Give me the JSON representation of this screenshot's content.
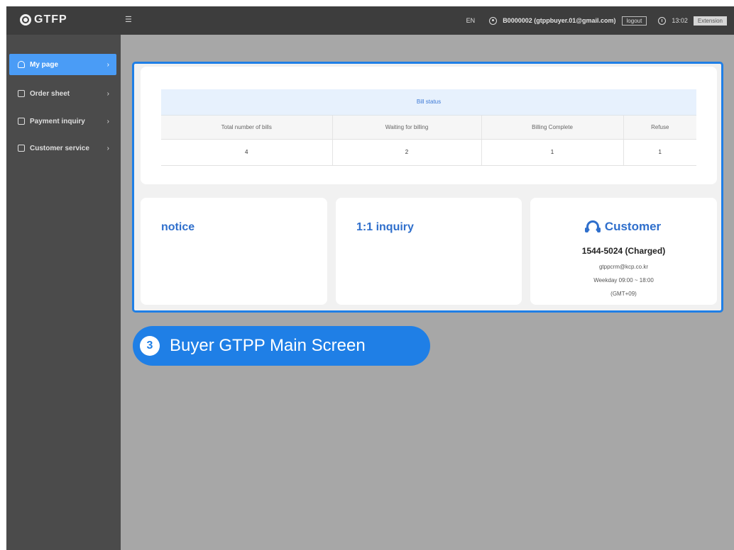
{
  "header": {
    "logo_text": "GTFP",
    "language": "EN",
    "user": "B0000002 (gtppbuyer.01@gmail.com)",
    "logout_label": "logout",
    "time": "13:02",
    "extension_label": "Extension"
  },
  "sidebar": {
    "items": [
      {
        "label": "My page",
        "icon": "person-icon",
        "active": true
      },
      {
        "label": "Order sheet",
        "icon": "document-icon",
        "active": false
      },
      {
        "label": "Payment inquiry",
        "icon": "clipboard-icon",
        "active": false
      },
      {
        "label": "Customer service",
        "icon": "grid-icon",
        "active": false
      }
    ]
  },
  "bill_status": {
    "caption": "Bill status",
    "columns": [
      "Total number of bills",
      "Waiting for billing",
      "Billing Complete",
      "Refuse"
    ],
    "values": [
      "4",
      "2",
      "1",
      "1"
    ]
  },
  "cards": {
    "notice_title": "notice",
    "inquiry_title": "1:1 inquiry",
    "customer": {
      "title": "Customer",
      "phone": "1544-5024 (Charged)",
      "email": "gtppcrm@kcp.co.kr",
      "hours": "Weekday 09:00 ~ 18:00",
      "timezone": "(GMT+09)"
    }
  },
  "step": {
    "number": "3",
    "label": "Buyer GTPP Main Screen"
  },
  "colors": {
    "accent": "#1f7fe6",
    "sidebar_active": "#4a9cf6",
    "header_bg": "#3d3d3d",
    "sidebar_bg": "#4b4b4b",
    "overlay_bg": "#a7a7a7"
  }
}
